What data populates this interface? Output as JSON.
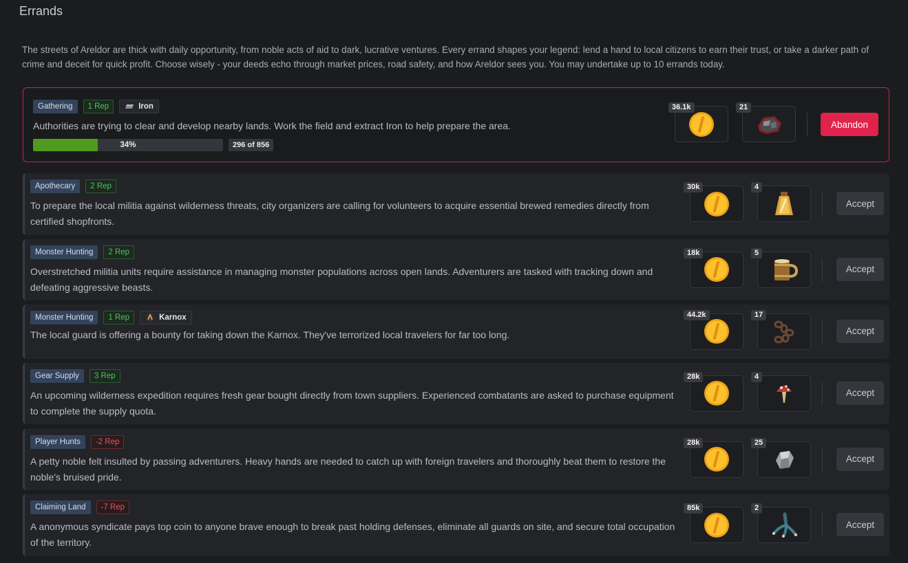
{
  "page": {
    "title": "Errands",
    "intro": "The streets of Areldor are thick with daily opportunity, from noble acts of aid to dark, lucrative ventures. Every errand shapes your legend: lend a hand to local citizens to earn their trust, or take a darker path of crime and deceit for quick profit. Choose wisely - your deeds echo through market prices, road safety, and how Areldor sees you. You may undertake up to 10 errands today."
  },
  "active": {
    "category": "Gathering",
    "rep": "1 Rep",
    "item": "Iron",
    "description": "Authorities are trying to clear and develop nearby lands. Work the field and extract Iron to help prepare the area.",
    "progress_percent": 34,
    "progress_label": "34%",
    "progress_count": "296 of 856",
    "reward_gold": "36.1k",
    "reward_item_qty": "21",
    "reward_item_icon": "iron-ore-icon",
    "action": "Abandon"
  },
  "errands": [
    {
      "category": "Apothecary",
      "rep": "2 Rep",
      "rep_type": "pos",
      "description": "To prepare the local militia against wilderness threats, city organizers are calling for volunteers to acquire essential brewed remedies directly from certified shopfronts.",
      "gold": "30k",
      "item_qty": "4",
      "item_icon": "potion-flask-icon",
      "action": "Accept"
    },
    {
      "category": "Monster Hunting",
      "rep": "2 Rep",
      "rep_type": "pos",
      "description": "Overstretched militia units require assistance in managing monster populations across open lands. Adventurers are tasked with tracking down and defeating aggressive beasts.",
      "gold": "18k",
      "item_qty": "5",
      "item_icon": "wooden-mug-icon",
      "action": "Accept"
    },
    {
      "category": "Monster Hunting",
      "rep": "1 Rep",
      "rep_type": "pos",
      "item": "Karnox",
      "description": "The local guard is offering a bounty for taking down the Karnox. They've terrorized local travelers for far too long.",
      "gold": "44.2k",
      "item_qty": "17",
      "item_icon": "chain-icon",
      "action": "Accept"
    },
    {
      "category": "Gear Supply",
      "rep": "3 Rep",
      "rep_type": "pos",
      "description": "An upcoming wilderness expedition requires fresh gear bought directly from town suppliers. Experienced combatants are asked to purchase equipment to complete the supply quota.",
      "gold": "28k",
      "item_qty": "4",
      "item_icon": "mushroom-icon",
      "action": "Accept"
    },
    {
      "category": "Player Hunts",
      "rep": "-2 Rep",
      "rep_type": "neg",
      "description": "A petty noble felt insulted by passing adventurers. Heavy hands are needed to catch up with foreign travelers and thoroughly beat them to restore the noble's bruised pride.",
      "gold": "28k",
      "item_qty": "25",
      "item_icon": "stone-icon",
      "action": "Accept"
    },
    {
      "category": "Claiming Land",
      "rep": "-7 Rep",
      "rep_type": "neg",
      "description": "A anonymous syndicate pays top coin to anyone brave enough to break past holding defenses, eliminate all guards on site, and secure total occupation of the territory.",
      "gold": "85k",
      "item_qty": "2",
      "item_icon": "claw-icon",
      "action": "Accept"
    }
  ]
}
